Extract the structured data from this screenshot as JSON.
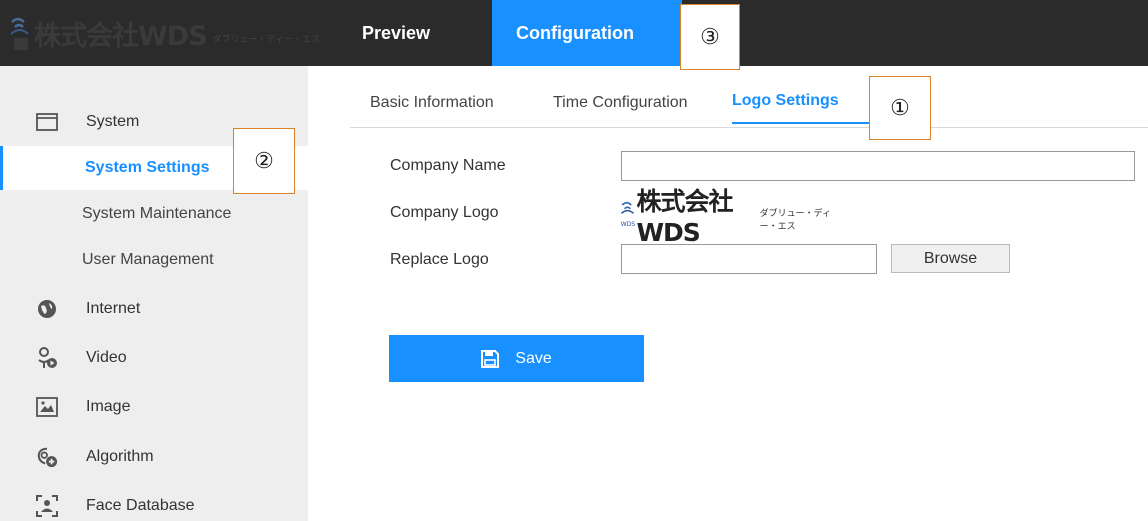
{
  "brand": {
    "name": "株式会社WDS",
    "sub": "ダブリュー・ディー・エス"
  },
  "topnav": {
    "tabs": [
      {
        "label": "Preview"
      },
      {
        "label": "Configuration"
      }
    ]
  },
  "annotations": {
    "one": "①",
    "two": "②",
    "three": "③"
  },
  "sidebar": {
    "items": [
      {
        "label": "System",
        "icon": "system-icon"
      },
      {
        "label": "System Settings"
      },
      {
        "label": "System Maintenance"
      },
      {
        "label": "User Management"
      },
      {
        "label": "Internet",
        "icon": "internet-icon"
      },
      {
        "label": "Video",
        "icon": "video-icon"
      },
      {
        "label": "Image",
        "icon": "image-icon"
      },
      {
        "label": "Algorithm",
        "icon": "algorithm-icon"
      },
      {
        "label": "Face Database",
        "icon": "face-database-icon"
      }
    ]
  },
  "tabs": {
    "basic": "Basic Information",
    "time": "Time Configuration",
    "logo": "Logo Settings"
  },
  "form": {
    "company_name_label": "Company Name",
    "company_name_value": "",
    "company_logo_label": "Company Logo",
    "replace_logo_label": "Replace Logo",
    "replace_logo_value": "",
    "browse_label": "Browse",
    "save_label": "Save"
  },
  "colors": {
    "accent": "#1890ff",
    "topbar": "#2b2b2b",
    "sidebar": "#eeeeee",
    "annotation_border": "#d9822b"
  }
}
